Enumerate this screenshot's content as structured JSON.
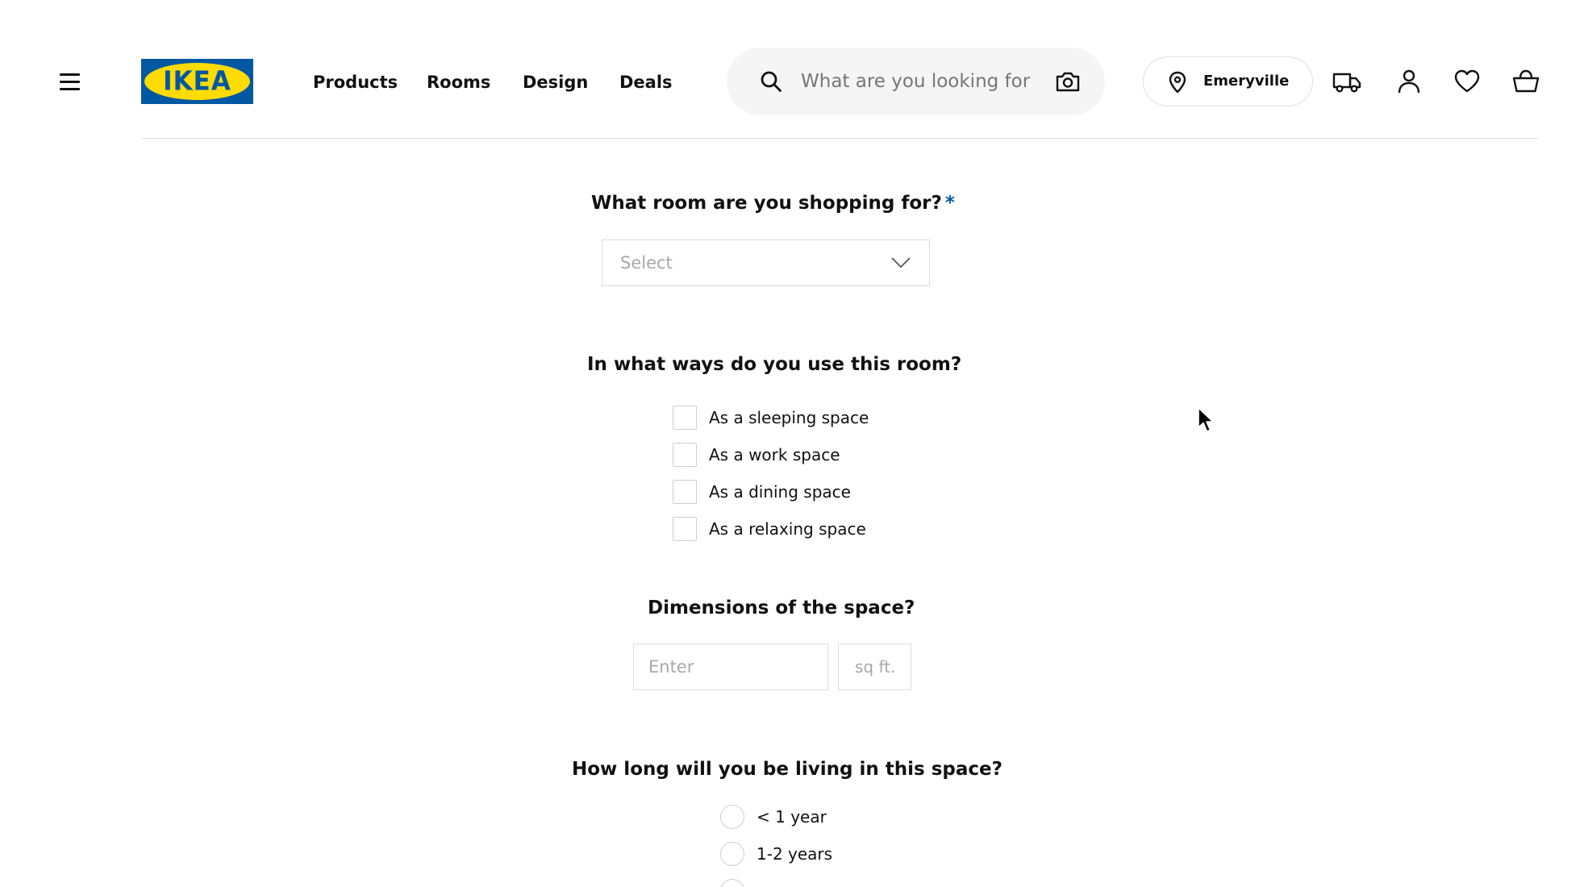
{
  "header": {
    "menu_icon": "hamburger-menu-icon",
    "logo": "IKEA",
    "nav": [
      {
        "label": "Products"
      },
      {
        "label": "Rooms"
      },
      {
        "label": "Design"
      },
      {
        "label": "Deals"
      }
    ],
    "search": {
      "placeholder": "What are you looking for",
      "search_icon": "search-icon",
      "camera_icon": "camera-icon"
    },
    "store": {
      "label": "Emeryville",
      "icon": "location-pin-icon"
    },
    "icons": [
      "delivery-truck-icon",
      "user-icon",
      "heart-icon",
      "shopping-basket-icon"
    ]
  },
  "form": {
    "room": {
      "question": "What room are you shopping for?",
      "required_mark": "*",
      "select_placeholder": "Select"
    },
    "usage": {
      "question": "In what ways do you use this room?",
      "options": [
        {
          "label": "As a sleeping space",
          "checked": false
        },
        {
          "label": "As a work space",
          "checked": false
        },
        {
          "label": "As a dining space",
          "checked": false
        },
        {
          "label": "As a relaxing space",
          "checked": false
        }
      ]
    },
    "dimensions": {
      "question": "Dimensions of the space?",
      "input_placeholder": "Enter",
      "unit": "sq ft."
    },
    "duration": {
      "question": "How long will you be living in this space?",
      "options": [
        {
          "label": "< 1 year",
          "selected": false
        },
        {
          "label": "1-2 years",
          "selected": false
        },
        {
          "label": "",
          "selected": false
        }
      ]
    }
  },
  "colors": {
    "ikea_blue": "#0058a3",
    "ikea_yellow": "#ffdb00",
    "search_bg": "#f5f5f5",
    "border": "#dcdcdc",
    "placeholder": "#a8a8a8"
  }
}
